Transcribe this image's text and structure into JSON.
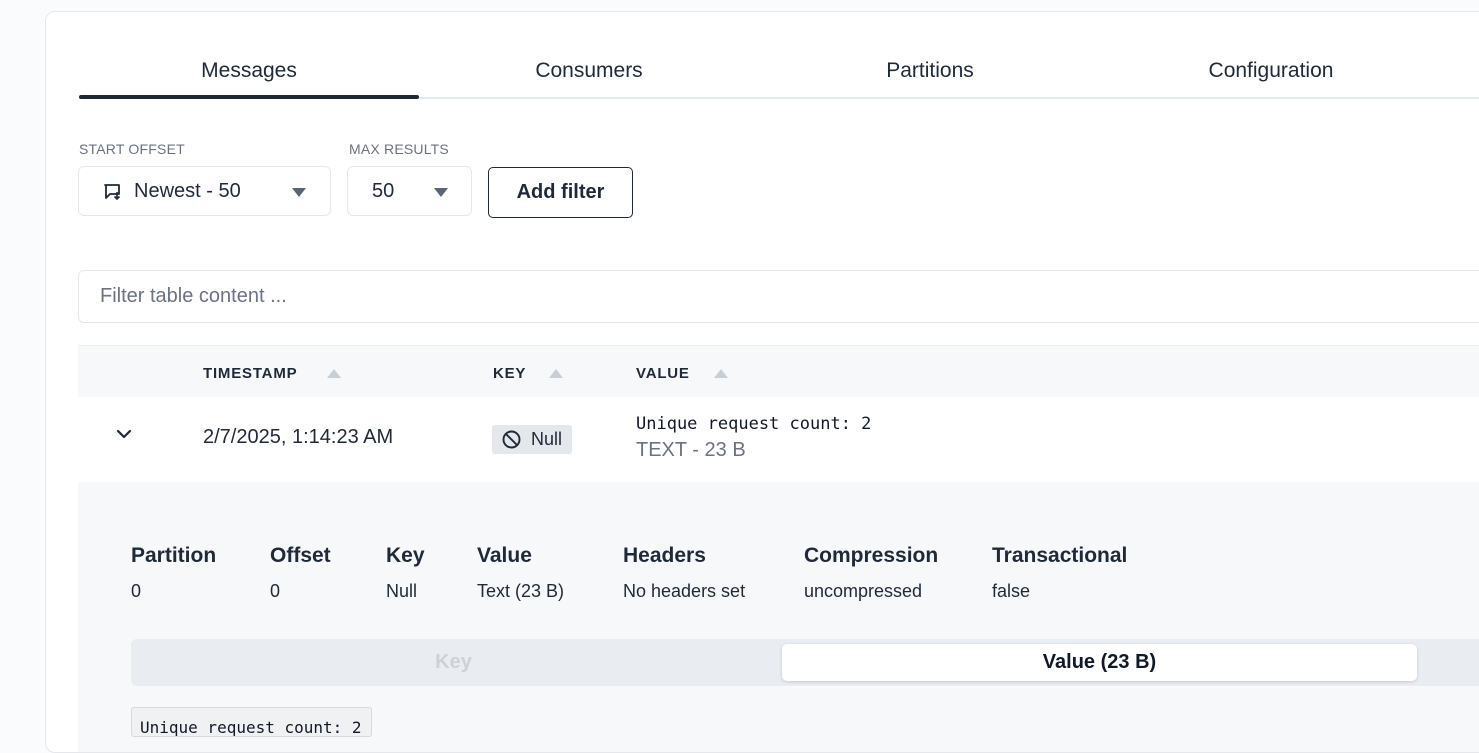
{
  "tabs": [
    {
      "label": "Messages",
      "active": true
    },
    {
      "label": "Consumers",
      "active": false
    },
    {
      "label": "Partitions",
      "active": false
    },
    {
      "label": "Configuration",
      "active": false
    }
  ],
  "controls": {
    "start_offset_label": "START OFFSET",
    "start_offset_value": "Newest - 50",
    "start_offset_icon": "message-arrow-icon",
    "max_results_label": "MAX RESULTS",
    "max_results_value": "50",
    "add_filter_label": "Add filter"
  },
  "search": {
    "placeholder": "Filter table content ..."
  },
  "table": {
    "columns": [
      "TIMESTAMP",
      "KEY",
      "VALUE"
    ],
    "rows": [
      {
        "timestamp": "2/7/2025, 1:14:23 AM",
        "key": "Null",
        "value": "Unique request count: 2",
        "value_meta": "TEXT - 23 B"
      }
    ]
  },
  "detail": {
    "headers": [
      "Partition",
      "Offset",
      "Key",
      "Value",
      "Headers",
      "Compression",
      "Transactional"
    ],
    "values": [
      "0",
      "0",
      "Null",
      "Text (23 B)",
      "No headers set",
      "uncompressed",
      "false"
    ],
    "segments": {
      "key": "Key",
      "value": "Value (23 B)"
    },
    "code": "Unique request count: 2"
  },
  "colors": {
    "accent": "#1e2937",
    "muted": "#6b7280",
    "panel": "#f7f8fa"
  }
}
